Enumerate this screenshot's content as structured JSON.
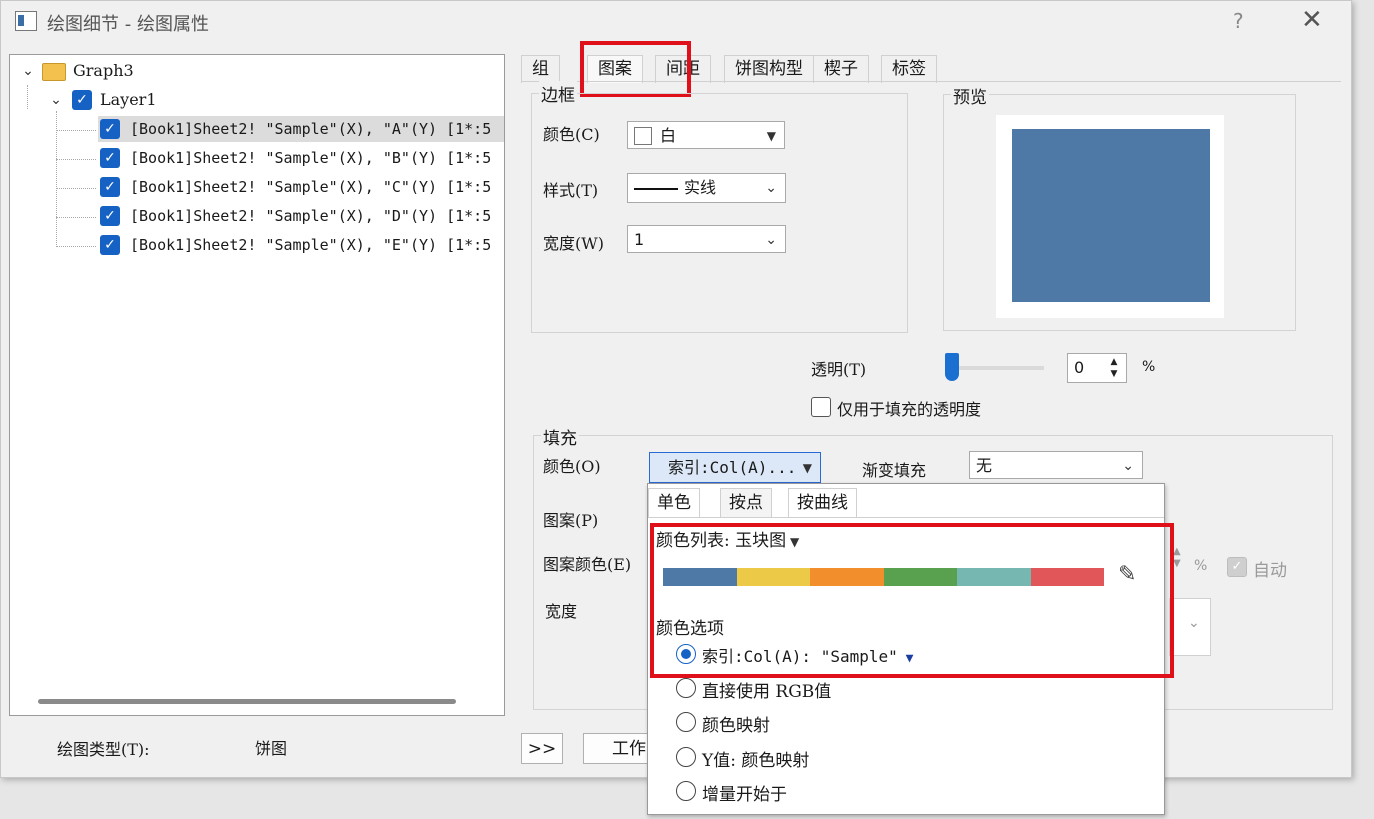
{
  "window": {
    "title": "绘图细节 - 绘图属性",
    "help": "?",
    "close": "✕"
  },
  "tree": {
    "root": "Graph3",
    "layer": "Layer1",
    "items": [
      "[Book1]Sheet2! \"Sample\"(X), \"A\"(Y) [1*:5",
      "[Book1]Sheet2! \"Sample\"(X), \"B\"(Y) [1*:5",
      "[Book1]Sheet2! \"Sample\"(X), \"C\"(Y) [1*:5",
      "[Book1]Sheet2! \"Sample\"(X), \"D\"(Y) [1*:5",
      "[Book1]Sheet2! \"Sample\"(X), \"E\"(Y) [1*:5"
    ]
  },
  "tabs": [
    "组",
    "图案",
    "间距",
    "饼图构型",
    "楔子",
    "标签"
  ],
  "border": {
    "title": "边框",
    "color_label": "颜色(C)",
    "color_value": "白",
    "style_label": "样式(T)",
    "style_value": "实线",
    "width_label": "宽度(W)",
    "width_value": "1"
  },
  "preview": {
    "title": "预览",
    "fill_color": "#4e79a7"
  },
  "transparency": {
    "label": "透明(T)",
    "value": "0",
    "unit": "%",
    "level": 0,
    "checkbox_label": "仅用于填充的透明度"
  },
  "fill": {
    "title": "填充",
    "color_label": "颜色(O)",
    "color_value": "索引:Col(A)...",
    "gradient_label": "渐变填充",
    "gradient_value": "无",
    "pattern_label": "图案(P)",
    "pattern_color_label": "图案颜色(E)",
    "width_label": "宽度",
    "auto_label": "自动",
    "percent": "%"
  },
  "popup": {
    "tabs": [
      "单色",
      "按点",
      "按曲线"
    ],
    "color_list_label": "颜色列表: 玉块图",
    "swatches": [
      "#4e79a7",
      "#edc948",
      "#f28e2b",
      "#59a14f",
      "#76b7b2",
      "#e15759"
    ],
    "color_options_label": "颜色选项",
    "options": [
      {
        "label": "索引:Col(A): \"Sample\"",
        "selected": true
      },
      {
        "label": "直接使用 RGB值",
        "selected": false
      },
      {
        "label": "颜色映射",
        "selected": false
      },
      {
        "label": "Y值: 颜色映射",
        "selected": false
      },
      {
        "label": "增量开始于",
        "selected": false
      }
    ]
  },
  "bottom": {
    "plot_type_label": "绘图类型(T):",
    "plot_type_value": "饼图",
    "expand_button": ">>",
    "workbook_button": "工作"
  },
  "highlight_color": "#e0101a"
}
